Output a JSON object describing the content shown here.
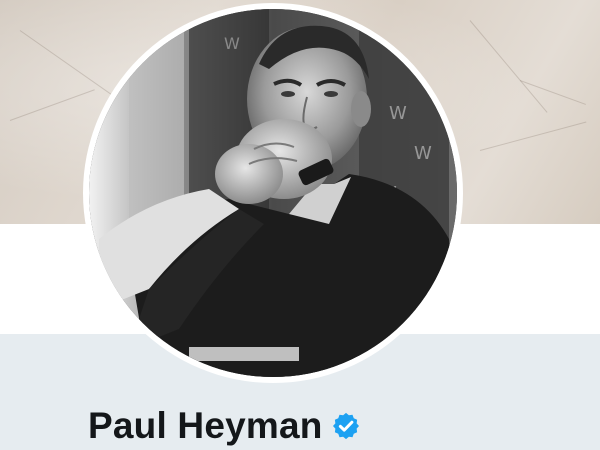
{
  "profile": {
    "display_name": "Paul Heyman",
    "verified": true,
    "verified_icon": "verified-badge-icon",
    "avatar_icon": "avatar-photo"
  },
  "colors": {
    "name_text": "#14171a",
    "verified_blue": "#1da1f2",
    "page_background": "#e6ecf0",
    "header_band": "#ffffff"
  }
}
